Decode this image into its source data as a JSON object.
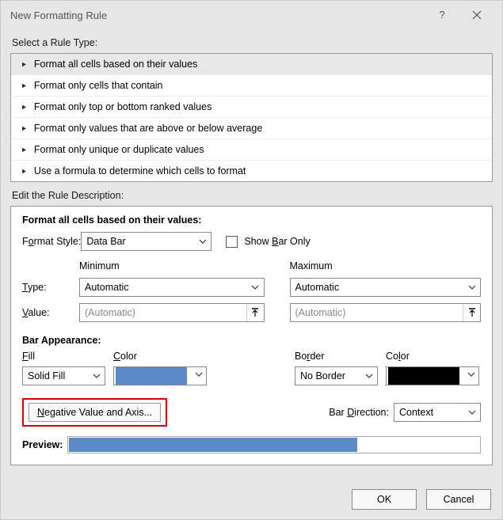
{
  "title": "New Formatting Rule",
  "section_select_rule": "Select a Rule Type:",
  "rule_types": [
    "Format all cells based on their values",
    "Format only cells that contain",
    "Format only top or bottom ranked values",
    "Format only values that are above or below average",
    "Format only unique or duplicate values",
    "Use a formula to determine which cells to format"
  ],
  "section_edit_desc": "Edit the Rule Description:",
  "desc_heading": "Format all cells based on their values:",
  "format_style_label": "Format Style:",
  "format_style_value": "Data Bar",
  "show_bar_only_label": "Show Bar Only",
  "col_minimum": "Minimum",
  "col_maximum": "Maximum",
  "type_label": "Type:",
  "type_min_value": "Automatic",
  "type_max_value": "Automatic",
  "value_label": "Value:",
  "value_min_placeholder": "(Automatic)",
  "value_max_placeholder": "(Automatic)",
  "bar_appearance_label": "Bar Appearance:",
  "fill_label": "Fill",
  "fill_color_label": "Color",
  "fill_value": "Solid Fill",
  "fill_color_hex": "#5b8ac6",
  "border_label": "Border",
  "border_color_label": "Color",
  "border_value": "No Border",
  "border_color_hex": "#000000",
  "negative_btn": "Negative Value and Axis...",
  "bar_direction_label": "Bar Direction:",
  "bar_direction_value": "Context",
  "preview_label": "Preview:",
  "preview_fill_pct": 70,
  "ok_label": "OK",
  "cancel_label": "Cancel"
}
